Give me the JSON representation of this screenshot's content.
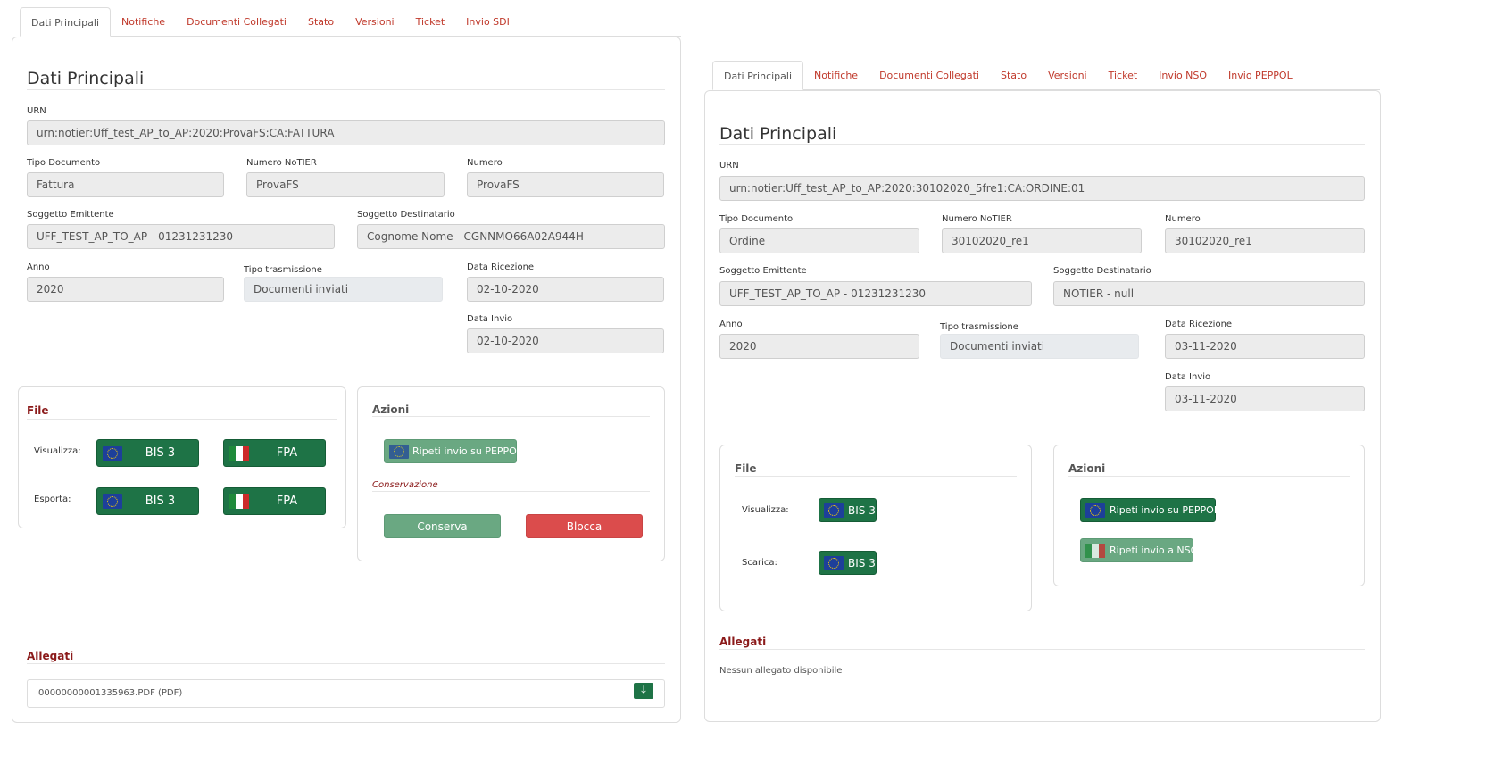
{
  "left": {
    "tabs": [
      "Dati Principali",
      "Notifiche",
      "Documenti Collegati",
      "Stato",
      "Versioni",
      "Ticket",
      "Invio SDI"
    ],
    "title": "Dati Principali",
    "urn_label": "URN",
    "urn": "urn:notier:Uff_test_AP_to_AP:2020:ProvaFS:CA:FATTURA",
    "tipo_documento_label": "Tipo Documento",
    "tipo_documento": "Fattura",
    "numero_notier_label": "Numero NoTIER",
    "numero_notier": "ProvaFS",
    "numero_label": "Numero",
    "numero": "ProvaFS",
    "soggetto_emittente_label": "Soggetto Emittente",
    "soggetto_emittente": "UFF_TEST_AP_TO_AP - 01231231230",
    "soggetto_destinatario_label": "Soggetto Destinatario",
    "soggetto_destinatario": "Cognome Nome - CGNNMO66A02A944H",
    "anno_label": "Anno",
    "anno": "2020",
    "tipo_trasmissione_label": "Tipo trasmissione",
    "tipo_trasmissione": "Documenti inviati",
    "data_ricezione_label": "Data Ricezione",
    "data_ricezione": "02-10-2020",
    "data_invio_label": "Data Invio",
    "data_invio": "02-10-2020",
    "file": {
      "title": "File",
      "visualizza_label": "Visualizza:",
      "esporta_label": "Esporta:",
      "bis3": "BIS 3",
      "fpa": "FPA"
    },
    "azioni": {
      "title": "Azioni",
      "ripeti_peppol": "Ripeti invio su PEPPOL",
      "conservazione": "Conservazione",
      "conserva": "Conserva",
      "blocca": "Blocca"
    },
    "allegati": {
      "title": "Allegati",
      "file": "00000000001335963.PDF (PDF)"
    }
  },
  "right": {
    "tabs": [
      "Dati Principali",
      "Notifiche",
      "Documenti Collegati",
      "Stato",
      "Versioni",
      "Ticket",
      "Invio NSO",
      "Invio PEPPOL"
    ],
    "title": "Dati Principali",
    "urn_label": "URN",
    "urn": "urn:notier:Uff_test_AP_to_AP:2020:30102020_5fre1:CA:ORDINE:01",
    "tipo_documento_label": "Tipo Documento",
    "tipo_documento": "Ordine",
    "numero_notier_label": "Numero NoTIER",
    "numero_notier": "30102020_re1",
    "numero_label": "Numero",
    "numero": "30102020_re1",
    "soggetto_emittente_label": "Soggetto Emittente",
    "soggetto_emittente": "UFF_TEST_AP_TO_AP - 01231231230",
    "soggetto_destinatario_label": "Soggetto Destinatario",
    "soggetto_destinatario": "NOTIER - null",
    "anno_label": "Anno",
    "anno": "2020",
    "tipo_trasmissione_label": "Tipo trasmissione",
    "tipo_trasmissione": "Documenti inviati",
    "data_ricezione_label": "Data Ricezione",
    "data_ricezione": "03-11-2020",
    "data_invio_label": "Data Invio",
    "data_invio": "03-11-2020",
    "file": {
      "title": "File",
      "visualizza_label": "Visualizza:",
      "scarica_label": "Scarica:",
      "bis3": "BIS 3"
    },
    "azioni": {
      "title": "Azioni",
      "ripeti_peppol": "Ripeti invio su PEPPOL",
      "ripeti_nso": "Ripeti invio a NSO"
    },
    "allegati": {
      "title": "Allegati",
      "none": "Nessun allegato disponibile"
    }
  },
  "colors": {
    "tab_link": "#c0392b",
    "section_title": "#8b1a1a",
    "btn_green": "#1e7346",
    "btn_green_light": "#6aa882",
    "btn_red": "#db4c4c"
  },
  "icons": {
    "eu_flag": "eu-flag-icon",
    "it_flag": "italy-flag-icon",
    "download": "download-icon"
  }
}
